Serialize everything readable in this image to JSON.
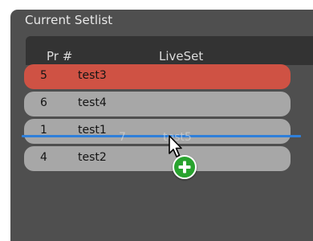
{
  "panel": {
    "title": "Current Setlist"
  },
  "columns": {
    "pr": "Pr #",
    "liveset": "LiveSet"
  },
  "rows": [
    {
      "number": "5",
      "name": "test3",
      "state": "selected"
    },
    {
      "number": "6",
      "name": "test4",
      "state": "normal"
    },
    {
      "number": "1",
      "name": "test1",
      "state": "normal"
    },
    {
      "number": "4",
      "name": "test2",
      "state": "normal"
    }
  ],
  "drag": {
    "ghost_number": "7",
    "ghost_name": "test5",
    "cursor_icon": "arrow-cursor-icon",
    "badge_icon": "plus-icon"
  },
  "colors": {
    "panel": "#4f4f4f",
    "header": "#333333",
    "row": "#a7a7a7",
    "row_selected": "#cf5244",
    "drop_indicator": "#2f7fd9",
    "add_badge": "#29a32f"
  }
}
